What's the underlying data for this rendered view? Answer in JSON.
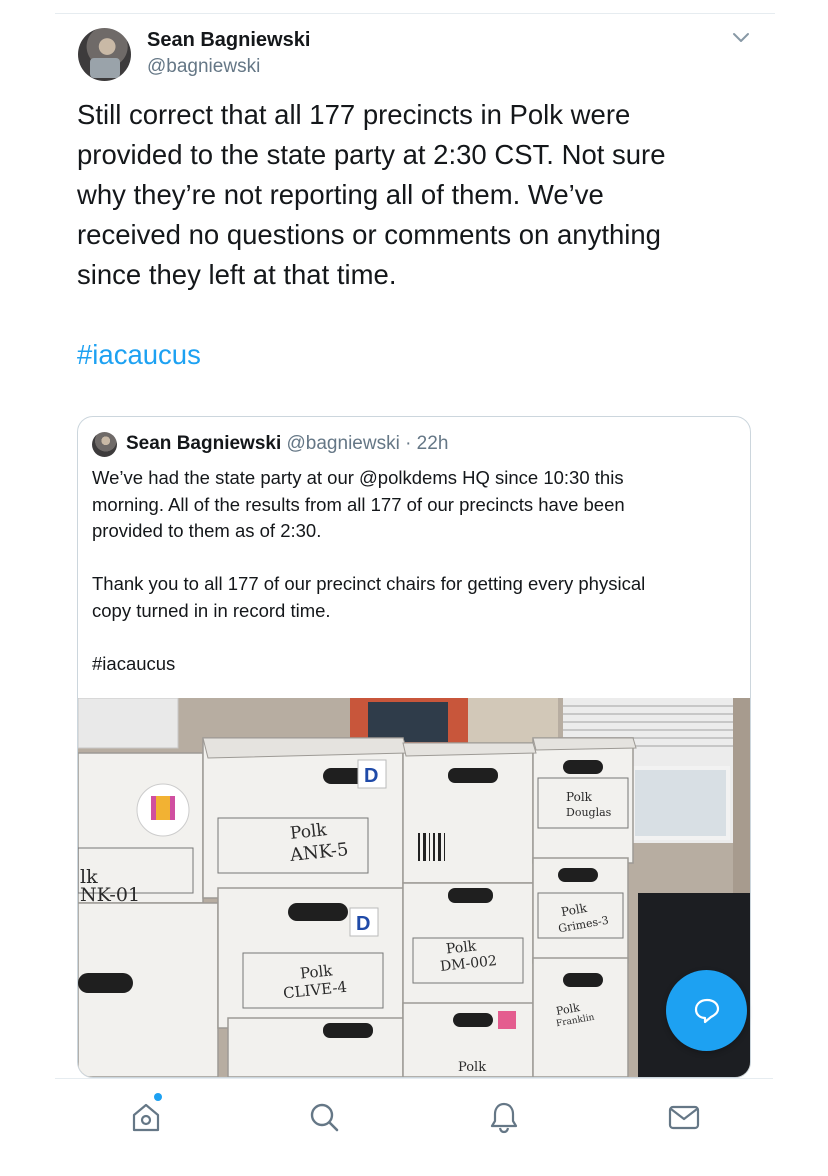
{
  "tweet": {
    "author_name": "Sean Bagniewski",
    "author_handle": "@bagniewski",
    "text": "Still correct that all 177 precincts in Polk were\nprovided to the state party at 2:30 CST. Not sure\nwhy they’re not reporting all of them. We’ve\nreceived no questions or comments on anything\nsince they left at that time.",
    "hashtag": "#iacaucus"
  },
  "quoted_tweet": {
    "author_name": "Sean Bagniewski",
    "meta": "@bagniewski · 22h",
    "text": "We’ve had the state party at our @polkdems HQ since 10:30 this\nmorning. All of the results from all 177 of our precincts have been\nprovided to them as of 2:30.\n\nThank you to all 177 of our precinct chairs for getting every physical\ncopy turned in in record time.\n\n#iacaucus"
  },
  "photo": {
    "box_labels": [
      "Polk",
      "ANK-5",
      "lk",
      "NK-01",
      "Polk",
      "CLIVE-4",
      "Polk",
      "DM-002",
      "Polk",
      "Douglas",
      "Polk",
      "Grimes-3",
      "Polk",
      "Franklin",
      "Polk"
    ]
  },
  "icons": {
    "caret": "chevron-down-icon",
    "compose": "compose-reply-icon",
    "tabs": [
      "home-icon",
      "search-icon",
      "notifications-icon",
      "messages-icon"
    ]
  },
  "colors": {
    "accent": "#1da1f2",
    "text": "#14171a",
    "secondary": "#657786",
    "border": "#ccd6dd"
  }
}
